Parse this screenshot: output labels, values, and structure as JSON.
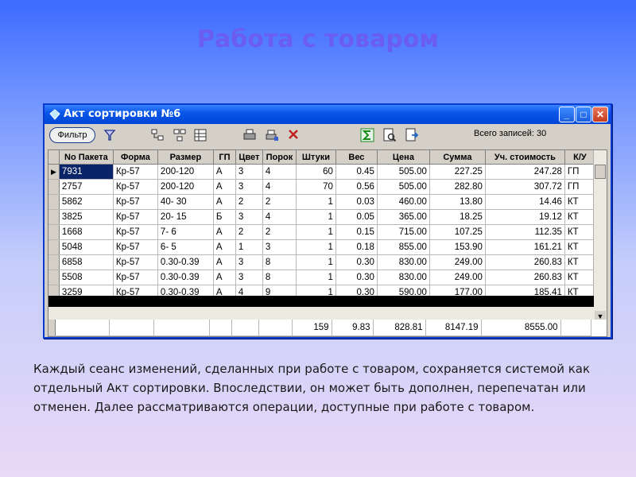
{
  "slide": {
    "title": "Работа с товаром",
    "caption": "Каждый сеанс изменений, сделанных при работе с товаром, сохраняется системой как отдельный Акт сортировки. Впоследствии, он может быть дополнен, перепечатан или отменен.  Далее рассматриваются операции, доступные при работе с товаром."
  },
  "window": {
    "title": "Акт сортировки №6",
    "minimize": "_",
    "maximize": "□",
    "close": "✕"
  },
  "toolbar": {
    "filter_label": "Фильтр",
    "total_records": "Всего записей: 30",
    "icons": [
      "funnel-icon",
      "tree-icon",
      "tree-add-icon",
      "grid-icon",
      "print-icon",
      "print-preview-icon",
      "edit-delete-icon",
      "sum-icon",
      "search-doc-icon",
      "export-icon"
    ]
  },
  "table": {
    "columns": [
      "No Пакета",
      "Форма",
      "Размер",
      "ГП",
      "Цвет",
      "Порок",
      "Штуки",
      "Вес",
      "Цена",
      "Сумма",
      "Уч. стоимость",
      "К/У"
    ],
    "rows": [
      [
        "7931",
        "Кр-57",
        "200-120",
        "А",
        "3",
        "4",
        "60",
        "0.45",
        "505.00",
        "227.25",
        "247.28",
        "ГП"
      ],
      [
        "2757",
        "Кр-57",
        "200-120",
        "А",
        "3",
        "4",
        "70",
        "0.56",
        "505.00",
        "282.80",
        "307.72",
        "ГП"
      ],
      [
        "5862",
        "Кр-57",
        "40- 30",
        "А",
        "2",
        "2",
        "1",
        "0.03",
        "460.00",
        "13.80",
        "14.46",
        "КТ"
      ],
      [
        "3825",
        "Кр-57",
        "20- 15",
        "Б",
        "3",
        "4",
        "1",
        "0.05",
        "365.00",
        "18.25",
        "19.12",
        "КТ"
      ],
      [
        "1668",
        "Кр-57",
        "7- 6",
        "А",
        "2",
        "2",
        "1",
        "0.15",
        "715.00",
        "107.25",
        "112.35",
        "КТ"
      ],
      [
        "5048",
        "Кр-57",
        "6- 5",
        "А",
        "1",
        "3",
        "1",
        "0.18",
        "855.00",
        "153.90",
        "161.21",
        "КТ"
      ],
      [
        "6858",
        "Кр-57",
        "0.30-0.39",
        "А",
        "3",
        "8",
        "1",
        "0.30",
        "830.00",
        "249.00",
        "260.83",
        "КТ"
      ],
      [
        "5508",
        "Кр-57",
        "0.30-0.39",
        "А",
        "3",
        "8",
        "1",
        "0.30",
        "830.00",
        "249.00",
        "260.83",
        "КТ"
      ],
      [
        "3259",
        "Кр-57",
        "0.30-0.39",
        "А",
        "4",
        "9",
        "1",
        "0.30",
        "590.00",
        "177.00",
        "185.41",
        "КТ"
      ]
    ],
    "totals": [
      "",
      "",
      "",
      "",
      "",
      "",
      "159",
      "9.83",
      "828.81",
      "8147.19",
      "8555.00",
      ""
    ],
    "current_row_marker": "▶"
  }
}
